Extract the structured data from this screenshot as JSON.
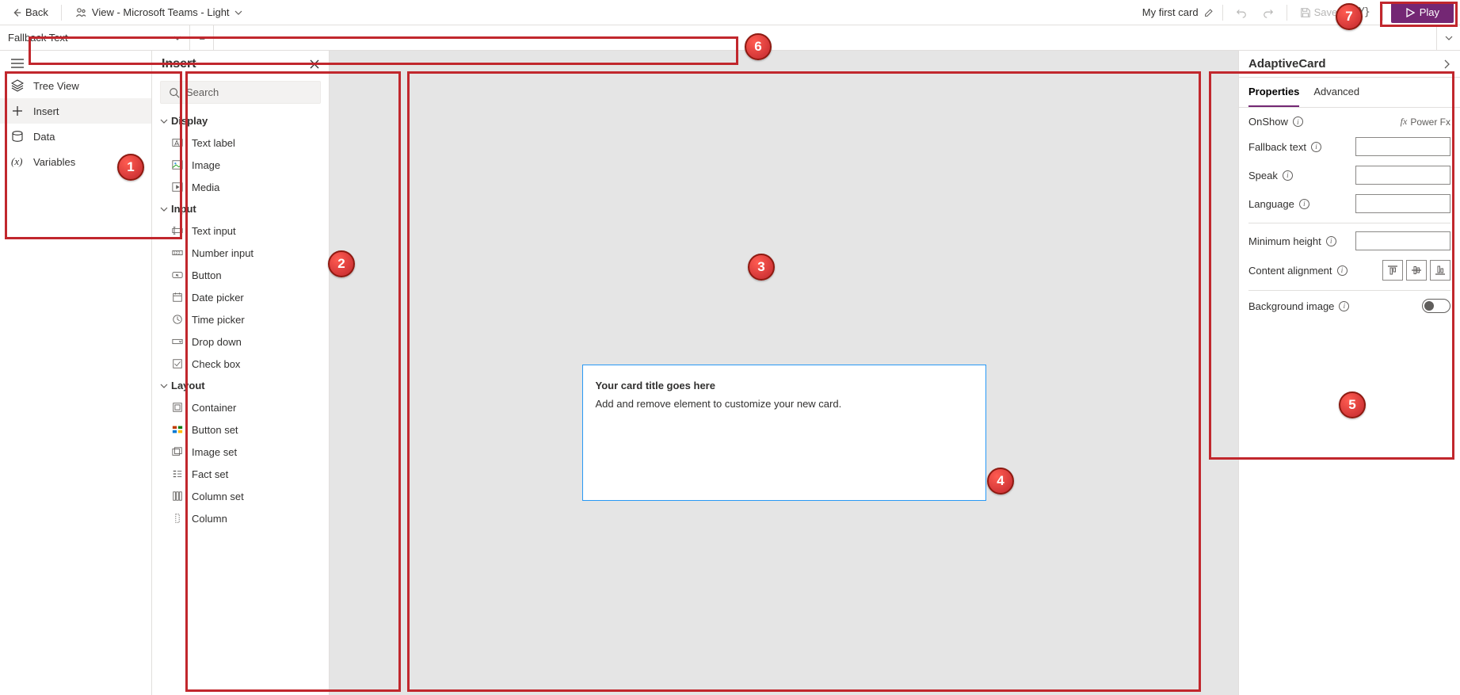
{
  "topbar": {
    "back": "Back",
    "view": "View - Microsoft Teams - Light",
    "card_name": "My first card",
    "save": "Save",
    "play": "Play"
  },
  "formula": {
    "prop": "Fallback Text"
  },
  "leftrail": {
    "tree": "Tree View",
    "insert": "Insert",
    "data": "Data",
    "vars": "Variables"
  },
  "insert": {
    "title": "Insert",
    "search": "Search",
    "groups": {
      "display": {
        "label": "Display",
        "items": [
          "Text label",
          "Image",
          "Media"
        ]
      },
      "input": {
        "label": "Input",
        "items": [
          "Text input",
          "Number input",
          "Button",
          "Date picker",
          "Time picker",
          "Drop down",
          "Check box"
        ]
      },
      "layout": {
        "label": "Layout",
        "items": [
          "Container",
          "Button set",
          "Image set",
          "Fact set",
          "Column set",
          "Column"
        ]
      }
    }
  },
  "card": {
    "title": "Your card title goes here",
    "subtitle": "Add and remove element to customize your new card."
  },
  "right": {
    "title": "AdaptiveCard",
    "tabs": {
      "props": "Properties",
      "adv": "Advanced"
    },
    "onshow": "OnShow",
    "powerfx": "Power Fx",
    "fallback": "Fallback text",
    "speak": "Speak",
    "lang": "Language",
    "minh": "Minimum height",
    "align": "Content alignment",
    "bgimg": "Background image"
  },
  "callouts": {
    "c1": "1",
    "c2": "2",
    "c3": "3",
    "c4": "4",
    "c5": "5",
    "c6": "6",
    "c7": "7"
  }
}
